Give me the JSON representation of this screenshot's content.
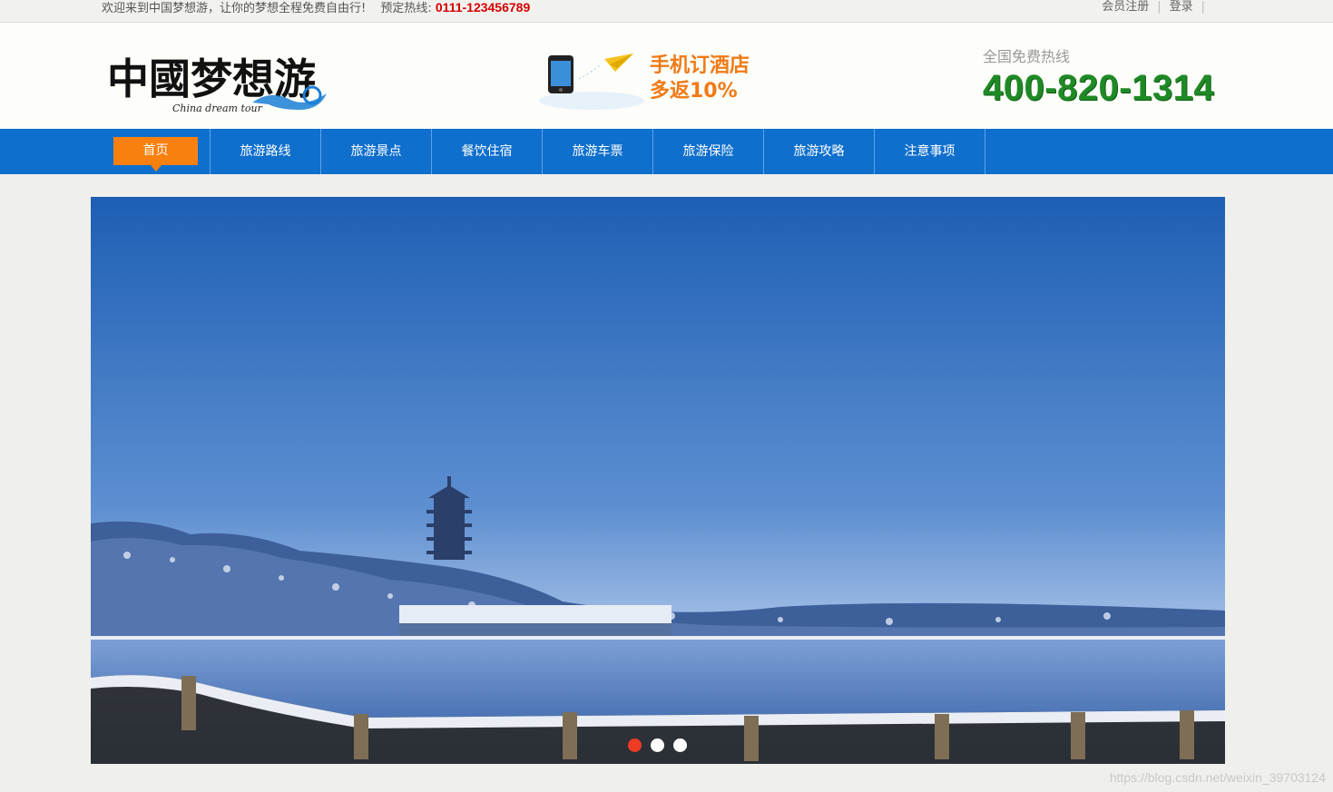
{
  "topbar": {
    "welcome": "欢迎来到中国梦想游，让你的梦想全程免费自由行!",
    "hotline_label": "预定热线:",
    "hotline_number": "0111-123456789",
    "register": "会员注册",
    "login": "登录",
    "separator": "|"
  },
  "header": {
    "logo_text": "中國梦想游",
    "logo_subtitle": "China dream tour",
    "promo_line1": "手机订酒店",
    "promo_line2": "多返10%",
    "phone_label": "全国免费热线",
    "phone_number": "400-820-1314"
  },
  "nav": {
    "items": [
      {
        "label": "首页",
        "active": true
      },
      {
        "label": "旅游路线"
      },
      {
        "label": "旅游景点"
      },
      {
        "label": "餐饮住宿"
      },
      {
        "label": "旅游车票"
      },
      {
        "label": "旅游保险"
      },
      {
        "label": "旅游攻略"
      },
      {
        "label": "注意事项"
      }
    ]
  },
  "banner": {
    "slides_count": 3,
    "active_slide": 1
  },
  "watermark": "https://blog.csdn.net/weixin_39703124",
  "colors": {
    "nav_bg": "#0f6fcd",
    "nav_active": "#f7800f",
    "hotline": "#d40000",
    "phone_number": "#1f8a25",
    "promo": "#f07a16"
  }
}
